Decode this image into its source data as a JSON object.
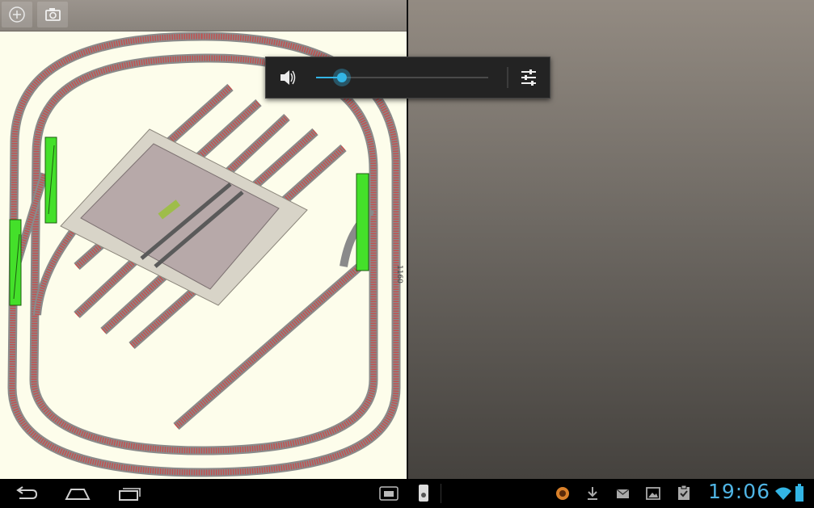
{
  "app": {
    "toolbar": {
      "add_icon": "add-circle-icon",
      "camera_icon": "camera-icon"
    },
    "layout": {
      "dimension_label": "1160",
      "colors": {
        "canvas": "#fdfdeb",
        "track_rail": "#8a8a8a",
        "track_ties": "#c4504f",
        "block_highlight": "#44e02a",
        "platform": "#b7a9a9"
      }
    }
  },
  "volume": {
    "level": 0.15,
    "speaker_icon": "volume-icon",
    "settings_icon": "sliders-icon"
  },
  "navbar": {
    "back_icon": "back-icon",
    "home_icon": "home-icon",
    "recents_icon": "recent-apps-icon",
    "screen_icon": "screen-compat-icon",
    "notif_icons": [
      "sync-icon",
      "download-icon",
      "mail-icon",
      "image-icon",
      "clipboard-check-icon"
    ],
    "time": "19:06",
    "status_icons": [
      "wifi-icon",
      "battery-icon"
    ]
  }
}
